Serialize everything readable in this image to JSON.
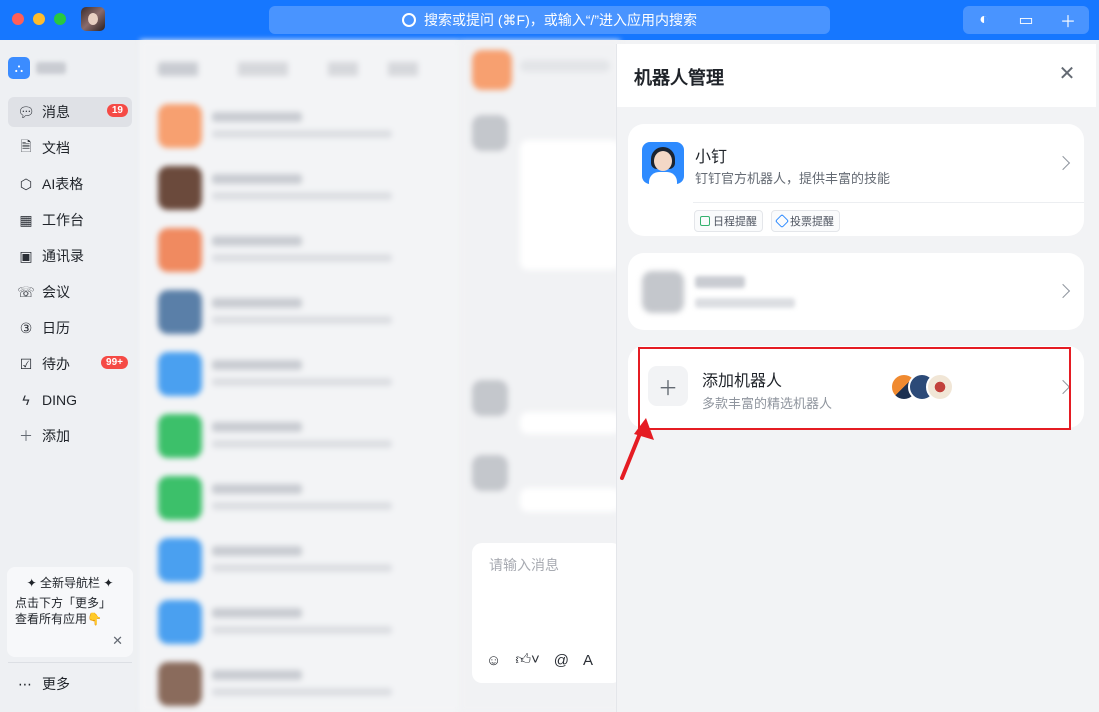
{
  "search": {
    "placeholder": "搜索或提问 (⌘F)，或输入“/”进入应用内搜索"
  },
  "nav": {
    "items": [
      {
        "label": "消息",
        "icon": "message-icon",
        "badge": "19"
      },
      {
        "label": "文档",
        "icon": "document-icon"
      },
      {
        "label": "AI表格",
        "icon": "ai-table-icon"
      },
      {
        "label": "工作台",
        "icon": "workbench-icon"
      },
      {
        "label": "通讯录",
        "icon": "contacts-icon"
      },
      {
        "label": "会议",
        "icon": "meeting-icon"
      },
      {
        "label": "日历",
        "icon": "calendar-icon"
      },
      {
        "label": "待办",
        "icon": "todo-icon",
        "badge": "99+"
      },
      {
        "label": "DING",
        "icon": "ding-icon"
      },
      {
        "label": "添加",
        "icon": "plus-icon"
      }
    ],
    "promo_title": "全新导航栏",
    "promo_line1": "点击下方「更多」",
    "promo_line2": "查看所有应用👇",
    "more_label": "更多"
  },
  "chat": {
    "input_placeholder": "请输入消息"
  },
  "panel": {
    "title": "机器人管理",
    "robot": {
      "name": "小钉",
      "desc": "钉钉官方机器人，提供丰富的技能",
      "chips": [
        "日程提醒",
        "投票提醒"
      ]
    },
    "add_robot": {
      "title": "添加机器人",
      "desc": "多款丰富的精选机器人"
    }
  },
  "colors": {
    "accent": "#1677ff",
    "highlight": "#e51c23",
    "badge": "#f54a45"
  }
}
